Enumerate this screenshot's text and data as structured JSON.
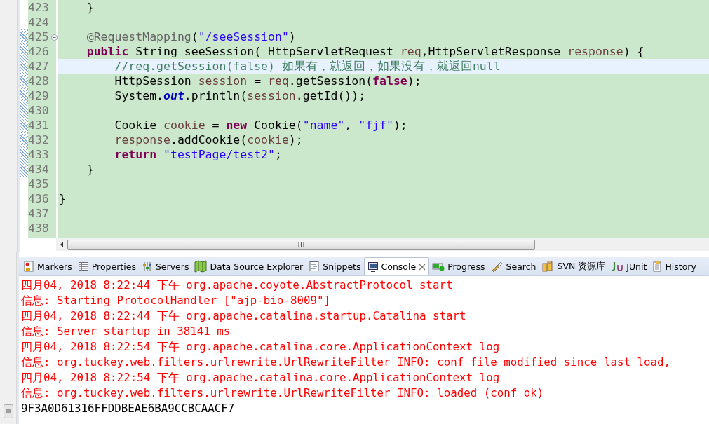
{
  "editor": {
    "lines": [
      {
        "number": "423",
        "marked": false,
        "current": false,
        "foldable": false,
        "tokens": [
          {
            "text": "    }",
            "kind": "plain"
          }
        ]
      },
      {
        "number": "424",
        "marked": false,
        "current": false,
        "foldable": false
      },
      {
        "number": "425",
        "marked": true,
        "current": false,
        "foldable": true,
        "tokens": [
          {
            "text": "    @RequestMapping",
            "kind": "annotation"
          },
          {
            "text": "(",
            "kind": "plain"
          },
          {
            "text": "\"/seeSession\"",
            "kind": "string"
          },
          {
            "text": ")",
            "kind": "plain"
          }
        ]
      },
      {
        "number": "426",
        "marked": true,
        "current": false,
        "foldable": false,
        "tokens": [
          {
            "text": "    public",
            "kind": "keyword"
          },
          {
            "text": " String seeSession( HttpServletRequest ",
            "kind": "plain"
          },
          {
            "text": "req",
            "kind": "local"
          },
          {
            "text": ",HttpServletResponse ",
            "kind": "plain"
          },
          {
            "text": "response",
            "kind": "local"
          },
          {
            "text": ") {",
            "kind": "plain"
          }
        ]
      },
      {
        "number": "427",
        "marked": true,
        "current": true,
        "foldable": false,
        "tokens": [
          {
            "text": "        //req.getSession(false) 如果有，就返回，如果没有，就返回null",
            "kind": "comment"
          }
        ]
      },
      {
        "number": "428",
        "marked": true,
        "current": false,
        "foldable": false,
        "tokens": [
          {
            "text": "        HttpSession ",
            "kind": "plain"
          },
          {
            "text": "session",
            "kind": "local"
          },
          {
            "text": " = ",
            "kind": "plain"
          },
          {
            "text": "req",
            "kind": "local"
          },
          {
            "text": ".getSession(",
            "kind": "plain"
          },
          {
            "text": "false",
            "kind": "keyword"
          },
          {
            "text": ");",
            "kind": "plain"
          }
        ]
      },
      {
        "number": "429",
        "marked": true,
        "current": false,
        "foldable": false,
        "tokens": [
          {
            "text": "        System.",
            "kind": "plain"
          },
          {
            "text": "out",
            "kind": "static"
          },
          {
            "text": ".println(",
            "kind": "plain"
          },
          {
            "text": "session",
            "kind": "local"
          },
          {
            "text": ".getId());",
            "kind": "plain"
          }
        ]
      },
      {
        "number": "430",
        "marked": true,
        "current": false,
        "foldable": false
      },
      {
        "number": "431",
        "marked": true,
        "current": false,
        "foldable": false,
        "tokens": [
          {
            "text": "        Cookie ",
            "kind": "plain"
          },
          {
            "text": "cookie",
            "kind": "local"
          },
          {
            "text": " = ",
            "kind": "plain"
          },
          {
            "text": "new",
            "kind": "keyword"
          },
          {
            "text": " Cookie(",
            "kind": "plain"
          },
          {
            "text": "\"name\"",
            "kind": "string"
          },
          {
            "text": ", ",
            "kind": "plain"
          },
          {
            "text": "\"fjf\"",
            "kind": "string"
          },
          {
            "text": ");",
            "kind": "plain"
          }
        ]
      },
      {
        "number": "432",
        "marked": true,
        "current": false,
        "foldable": false,
        "tokens": [
          {
            "text": "        response",
            "kind": "local"
          },
          {
            "text": ".addCookie(",
            "kind": "plain"
          },
          {
            "text": "cookie",
            "kind": "local"
          },
          {
            "text": ");",
            "kind": "plain"
          }
        ]
      },
      {
        "number": "433",
        "marked": true,
        "current": false,
        "foldable": false,
        "tokens": [
          {
            "text": "        return",
            "kind": "keyword"
          },
          {
            "text": " \"testPage/test2\"",
            "kind": "string"
          },
          {
            "text": ";",
            "kind": "plain"
          }
        ]
      },
      {
        "number": "434",
        "marked": true,
        "current": false,
        "foldable": false,
        "tokens": [
          {
            "text": "    }",
            "kind": "plain"
          }
        ]
      },
      {
        "number": "435",
        "marked": false,
        "current": false,
        "foldable": false
      },
      {
        "number": "436",
        "marked": false,
        "current": false,
        "foldable": false,
        "tokens": [
          {
            "text": "}",
            "kind": "plain"
          }
        ]
      },
      {
        "number": "437",
        "marked": false,
        "current": false,
        "foldable": false
      },
      {
        "number": "438",
        "marked": false,
        "current": false,
        "foldable": false
      }
    ]
  },
  "views": {
    "tabs": [
      {
        "label": "Markers",
        "selected": false
      },
      {
        "label": "Properties",
        "selected": false
      },
      {
        "label": "Servers",
        "selected": false
      },
      {
        "label": "Data Source Explorer",
        "selected": false
      },
      {
        "label": "Snippets",
        "selected": false
      },
      {
        "label": "Console",
        "selected": true
      },
      {
        "label": "Progress",
        "selected": false
      },
      {
        "label": "Search",
        "selected": false
      },
      {
        "label": "SVN 资源库",
        "selected": false
      },
      {
        "label": "JUnit",
        "selected": false
      },
      {
        "label": "History",
        "selected": false
      }
    ]
  },
  "console": {
    "lines": [
      {
        "text": "四月04, 2018 8:22:44 下午 org.apache.coyote.AbstractProtocol start",
        "kind": "stderr"
      },
      {
        "text": "信息: Starting ProtocolHandler [\"ajp-bio-8009\"]",
        "kind": "stderr"
      },
      {
        "text": "四月04, 2018 8:22:44 下午 org.apache.catalina.startup.Catalina start",
        "kind": "stderr"
      },
      {
        "text": "信息: Server startup in 38141 ms",
        "kind": "stderr"
      },
      {
        "text": "四月04, 2018 8:22:54 下午 org.apache.catalina.core.ApplicationContext log",
        "kind": "stderr"
      },
      {
        "text": "信息: org.tuckey.web.filters.urlrewrite.UrlRewriteFilter INFO: conf file modified since last load,",
        "kind": "stderr"
      },
      {
        "text": "四月04, 2018 8:22:54 下午 org.apache.catalina.core.ApplicationContext log",
        "kind": "stderr"
      },
      {
        "text": "信息: org.tuckey.web.filters.urlrewrite.UrlRewriteFilter INFO: loaded (conf ok)",
        "kind": "stderr"
      },
      {
        "text": "9F3A0D61316FFDDBEAE6BA9CCBCAACF7",
        "kind": "stdout"
      }
    ]
  }
}
